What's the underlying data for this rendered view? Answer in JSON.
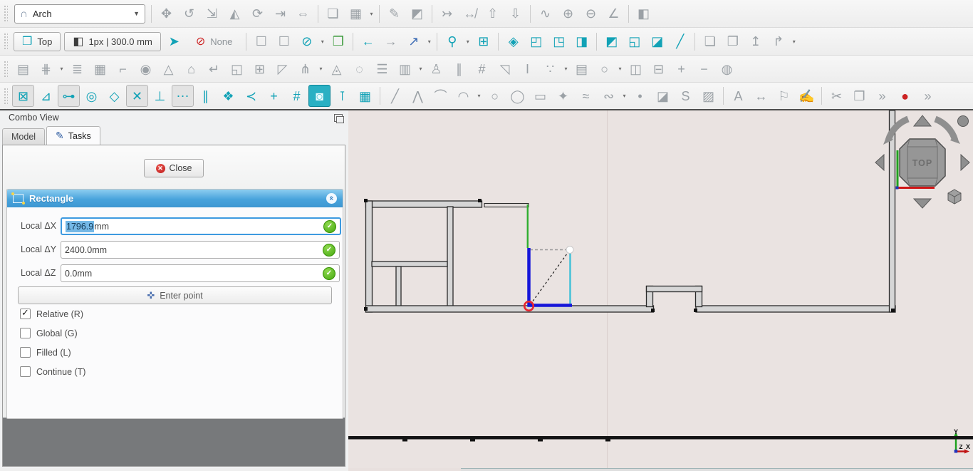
{
  "toolbars": {
    "row1": {
      "default_tone": "gray",
      "items": [
        {
          "kind": "handle"
        },
        {
          "kind": "combo",
          "name": "workbench-selector",
          "label": "Arch"
        },
        {
          "kind": "sep"
        },
        {
          "name": "draft-move",
          "glyph": "✥"
        },
        {
          "name": "draft-rotate",
          "glyph": "↺"
        },
        {
          "name": "draft-scale",
          "glyph": "⇲"
        },
        {
          "name": "draft-mirror",
          "glyph": "◭"
        },
        {
          "name": "draft-offset",
          "glyph": "⟳"
        },
        {
          "name": "draft-trimex",
          "glyph": "⇥"
        },
        {
          "name": "draft-stretch",
          "glyph": "⇔"
        },
        {
          "kind": "sep"
        },
        {
          "name": "draft-clone",
          "glyph": "❏"
        },
        {
          "name": "draft-array-tools",
          "glyph": "▦"
        },
        {
          "kind": "caret",
          "name": "array-tools-caret"
        },
        {
          "kind": "sep"
        },
        {
          "name": "draft-edit",
          "glyph": "✎"
        },
        {
          "name": "draft-subelement-highlight",
          "glyph": "◩"
        },
        {
          "kind": "sep"
        },
        {
          "name": "draft-join",
          "glyph": "↣"
        },
        {
          "name": "draft-split",
          "glyph": "↮"
        },
        {
          "name": "draft-upgrade",
          "glyph": "⇧"
        },
        {
          "name": "draft-downgrade",
          "glyph": "⇩"
        },
        {
          "kind": "sep"
        },
        {
          "name": "draft-wire-to-bspline",
          "glyph": "∿"
        },
        {
          "name": "draft-add-point",
          "glyph": "⊕"
        },
        {
          "name": "draft-remove-point",
          "glyph": "⊖"
        },
        {
          "name": "draft-slope",
          "glyph": "∠"
        },
        {
          "kind": "sep"
        },
        {
          "name": "draft-shape-2d-view",
          "glyph": "◧"
        }
      ]
    },
    "row2": {
      "default_tone": "teal",
      "items": [
        {
          "kind": "handle"
        },
        {
          "kind": "button",
          "name": "top-view-button",
          "glyph": "❒",
          "glyph_tone": "teal",
          "label": "Top"
        },
        {
          "kind": "button",
          "name": "line-style-button",
          "glyph": "◧",
          "glyph_tone": "dark",
          "label": "1px | 300.0 mm"
        },
        {
          "name": "apply-current-style",
          "glyph": "➤",
          "tone": "teal"
        },
        {
          "kind": "button",
          "name": "autogroup-button",
          "glyph": "⊘",
          "glyph_tone": "red",
          "label": "None",
          "flat": true
        },
        {
          "kind": "sep"
        },
        {
          "name": "box-element-selection",
          "glyph": "☐",
          "tone": "gray"
        },
        {
          "name": "box-selection",
          "glyph": "☐",
          "tone": "gray"
        },
        {
          "name": "block-notifications",
          "glyph": "⊘",
          "tone": "teal"
        },
        {
          "kind": "caret",
          "name": "block-notifications-caret"
        },
        {
          "name": "go-to-selection",
          "glyph": "❒",
          "tone": "green"
        },
        {
          "kind": "sep"
        },
        {
          "name": "nav-back",
          "glyph": "←",
          "tone": "teal"
        },
        {
          "name": "nav-forward",
          "glyph": "→",
          "tone": "gray"
        },
        {
          "name": "go-to-linked-object",
          "glyph": "↗",
          "tone": "blue"
        },
        {
          "kind": "caret",
          "name": "linked-object-caret"
        },
        {
          "kind": "sep"
        },
        {
          "name": "zoom-tools",
          "glyph": "⚲",
          "tone": "teal"
        },
        {
          "kind": "caret",
          "name": "zoom-caret"
        },
        {
          "name": "fit-all",
          "glyph": "⊞",
          "tone": "teal"
        },
        {
          "kind": "sep"
        },
        {
          "name": "view-axonometric",
          "glyph": "◈",
          "tone": "teal"
        },
        {
          "name": "view-front",
          "glyph": "◰",
          "tone": "teal"
        },
        {
          "name": "view-top",
          "glyph": "◳",
          "tone": "teal"
        },
        {
          "name": "view-right",
          "glyph": "◨",
          "tone": "teal"
        },
        {
          "kind": "sep"
        },
        {
          "name": "view-rear",
          "glyph": "◩",
          "tone": "teal"
        },
        {
          "name": "view-bottom",
          "glyph": "◱",
          "tone": "teal"
        },
        {
          "name": "view-left",
          "glyph": "◪",
          "tone": "teal"
        },
        {
          "name": "measure-distance",
          "glyph": "╱",
          "tone": "teal"
        },
        {
          "kind": "sep"
        },
        {
          "name": "create-part",
          "glyph": "❏",
          "tone": "gray"
        },
        {
          "name": "open-folder",
          "glyph": "❐",
          "tone": "gray"
        },
        {
          "name": "export",
          "glyph": "↥",
          "tone": "gray"
        },
        {
          "name": "share",
          "glyph": "↱",
          "tone": "gray"
        },
        {
          "kind": "caret",
          "name": "share-caret"
        }
      ]
    },
    "row3": {
      "default_tone": "gray",
      "items": [
        {
          "kind": "handle"
        },
        {
          "name": "arch-wall",
          "glyph": "▤"
        },
        {
          "name": "arch-structure",
          "glyph": "⋕"
        },
        {
          "kind": "caret",
          "name": "structure-caret"
        },
        {
          "name": "arch-rebar",
          "glyph": "≣"
        },
        {
          "name": "arch-curtain-wall",
          "glyph": "▦"
        },
        {
          "name": "arch-building-part",
          "glyph": "⌐"
        },
        {
          "name": "arch-project",
          "glyph": "◉"
        },
        {
          "name": "arch-site",
          "glyph": "△"
        },
        {
          "name": "arch-building",
          "glyph": "⌂"
        },
        {
          "name": "arch-level",
          "glyph": "↵"
        },
        {
          "name": "arch-external-reference",
          "glyph": "◱"
        },
        {
          "name": "arch-window",
          "glyph": "⊞"
        },
        {
          "name": "arch-roof",
          "glyph": "◸"
        },
        {
          "name": "arch-axis",
          "glyph": "⋔"
        },
        {
          "kind": "caret",
          "name": "axis-caret"
        },
        {
          "name": "arch-axis-system",
          "glyph": "◬"
        },
        {
          "name": "arch-section-plane",
          "glyph": "◌"
        },
        {
          "name": "arch-stairs",
          "glyph": "☰"
        },
        {
          "name": "arch-panel",
          "glyph": "▥"
        },
        {
          "kind": "caret",
          "name": "panel-caret"
        },
        {
          "name": "arch-equipment",
          "glyph": "♙"
        },
        {
          "name": "arch-profile",
          "glyph": "∥"
        },
        {
          "name": "arch-fence",
          "glyph": "#"
        },
        {
          "name": "arch-truss",
          "glyph": "◹"
        },
        {
          "name": "arch-beam",
          "glyph": "I"
        },
        {
          "name": "arch-material-tools",
          "glyph": "∵"
        },
        {
          "kind": "caret",
          "name": "material-caret"
        },
        {
          "name": "arch-schedule",
          "glyph": "▤"
        },
        {
          "name": "arch-pipe-tools",
          "glyph": "○"
        },
        {
          "kind": "caret",
          "name": "pipe-caret"
        },
        {
          "name": "arch-cut-plane",
          "glyph": "◫"
        },
        {
          "name": "arch-cut-with-line",
          "glyph": "⊟"
        },
        {
          "name": "arch-add-component",
          "glyph": "+"
        },
        {
          "name": "arch-remove-component",
          "glyph": "−"
        },
        {
          "name": "arch-survey",
          "glyph": "◍"
        }
      ]
    },
    "row4": {
      "default_tone": "teal",
      "items": [
        {
          "kind": "handle"
        },
        {
          "name": "snap-lock",
          "glyph": "⊠",
          "state": "pressed"
        },
        {
          "name": "snap-endpoint",
          "glyph": "⊿"
        },
        {
          "name": "snap-midpoint",
          "glyph": "⊶",
          "state": "pressed"
        },
        {
          "name": "snap-center",
          "glyph": "◎"
        },
        {
          "name": "snap-angle",
          "glyph": "◇"
        },
        {
          "name": "snap-intersection",
          "glyph": "✕",
          "state": "pressed"
        },
        {
          "name": "snap-perpendicular",
          "glyph": "⊥"
        },
        {
          "name": "snap-extension",
          "glyph": "⋯",
          "state": "pressed"
        },
        {
          "name": "snap-parallel",
          "glyph": "∥"
        },
        {
          "name": "snap-special",
          "glyph": "❖"
        },
        {
          "name": "snap-near",
          "glyph": "≺"
        },
        {
          "name": "snap-ortho",
          "glyph": "+"
        },
        {
          "name": "snap-grid",
          "glyph": "#"
        },
        {
          "name": "snap-working-plane",
          "glyph": "◙",
          "state": "pressed-teal"
        },
        {
          "name": "snap-dimensions",
          "glyph": "⊺"
        },
        {
          "name": "toggle-grid",
          "glyph": "▦"
        },
        {
          "kind": "sep"
        },
        {
          "name": "draft-line",
          "glyph": "╱",
          "tone": "gray"
        },
        {
          "name": "draft-polyline",
          "glyph": "⋀",
          "tone": "gray"
        },
        {
          "name": "draft-fillet",
          "glyph": "⌒",
          "tone": "gray"
        },
        {
          "name": "draft-arc-tools",
          "glyph": "◠",
          "tone": "gray"
        },
        {
          "kind": "caret",
          "name": "arc-tools-caret"
        },
        {
          "name": "draft-circle",
          "glyph": "○",
          "tone": "gray"
        },
        {
          "name": "draft-ellipse",
          "glyph": "◯",
          "tone": "gray"
        },
        {
          "name": "draft-rectangle",
          "glyph": "▭",
          "tone": "gray"
        },
        {
          "name": "draft-polygon",
          "glyph": "✦",
          "tone": "gray"
        },
        {
          "name": "draft-bspline",
          "glyph": "≈",
          "tone": "gray"
        },
        {
          "name": "draft-bezier-tools",
          "glyph": "∾",
          "tone": "gray"
        },
        {
          "kind": "caret",
          "name": "bezier-tools-caret"
        },
        {
          "name": "draft-point",
          "glyph": "•",
          "tone": "gray"
        },
        {
          "name": "draft-facebinder",
          "glyph": "◪",
          "tone": "gray"
        },
        {
          "name": "draft-shapestring",
          "glyph": "S",
          "tone": "gray"
        },
        {
          "name": "draft-hatch",
          "glyph": "▨",
          "tone": "gray"
        },
        {
          "kind": "sep"
        },
        {
          "name": "draft-text",
          "glyph": "A",
          "tone": "gray"
        },
        {
          "name": "draft-dimension",
          "glyph": "↔",
          "tone": "gray"
        },
        {
          "name": "draft-label",
          "glyph": "⚐",
          "tone": "gray"
        },
        {
          "name": "annotation-styles",
          "glyph": "✍",
          "tone": "gray"
        },
        {
          "kind": "sep"
        },
        {
          "name": "cut",
          "glyph": "✂",
          "tone": "gray"
        },
        {
          "name": "copy",
          "glyph": "❐",
          "tone": "gray"
        },
        {
          "name": "toolbar-overflow",
          "glyph": "»",
          "tone": "gray"
        },
        {
          "name": "macro-record",
          "glyph": "●",
          "tone": "red"
        },
        {
          "name": "toolbar-overflow-2",
          "glyph": "»",
          "tone": "gray"
        }
      ]
    }
  },
  "combo_view": {
    "title": "Combo View",
    "tabs": [
      {
        "label": "Model"
      },
      {
        "label": "Tasks"
      }
    ],
    "close_label": "Close",
    "section_title": "Rectangle",
    "fields": [
      {
        "label": "Local ΔX",
        "value": "1796.9",
        "unit": " mm"
      },
      {
        "label": "Local ΔY",
        "value": "2400.0",
        "unit": " mm"
      },
      {
        "label": "Local ΔZ",
        "value": "0.0",
        "unit": " mm"
      }
    ],
    "enter_point_label": "Enter point",
    "checkboxes": [
      {
        "label": "Relative (R)",
        "checked": true
      },
      {
        "label": "Global (G)",
        "checked": false
      },
      {
        "label": "Filled (L)",
        "checked": false
      },
      {
        "label": "Continue (T)",
        "checked": false
      }
    ]
  },
  "viewport": {
    "navcube_label": "TOP",
    "axis_x": "X",
    "axis_y": "Y",
    "axis_z": "Z",
    "colors": {
      "background": "#eae3e1",
      "preview_blue": "#1616d9",
      "preview_cyan": "#49c2d8",
      "snap_green": "#2fae2f",
      "snap_red": "#e8262f",
      "wall_fill": "#d6d6d6",
      "wall_stroke": "#2b2b2b"
    }
  }
}
